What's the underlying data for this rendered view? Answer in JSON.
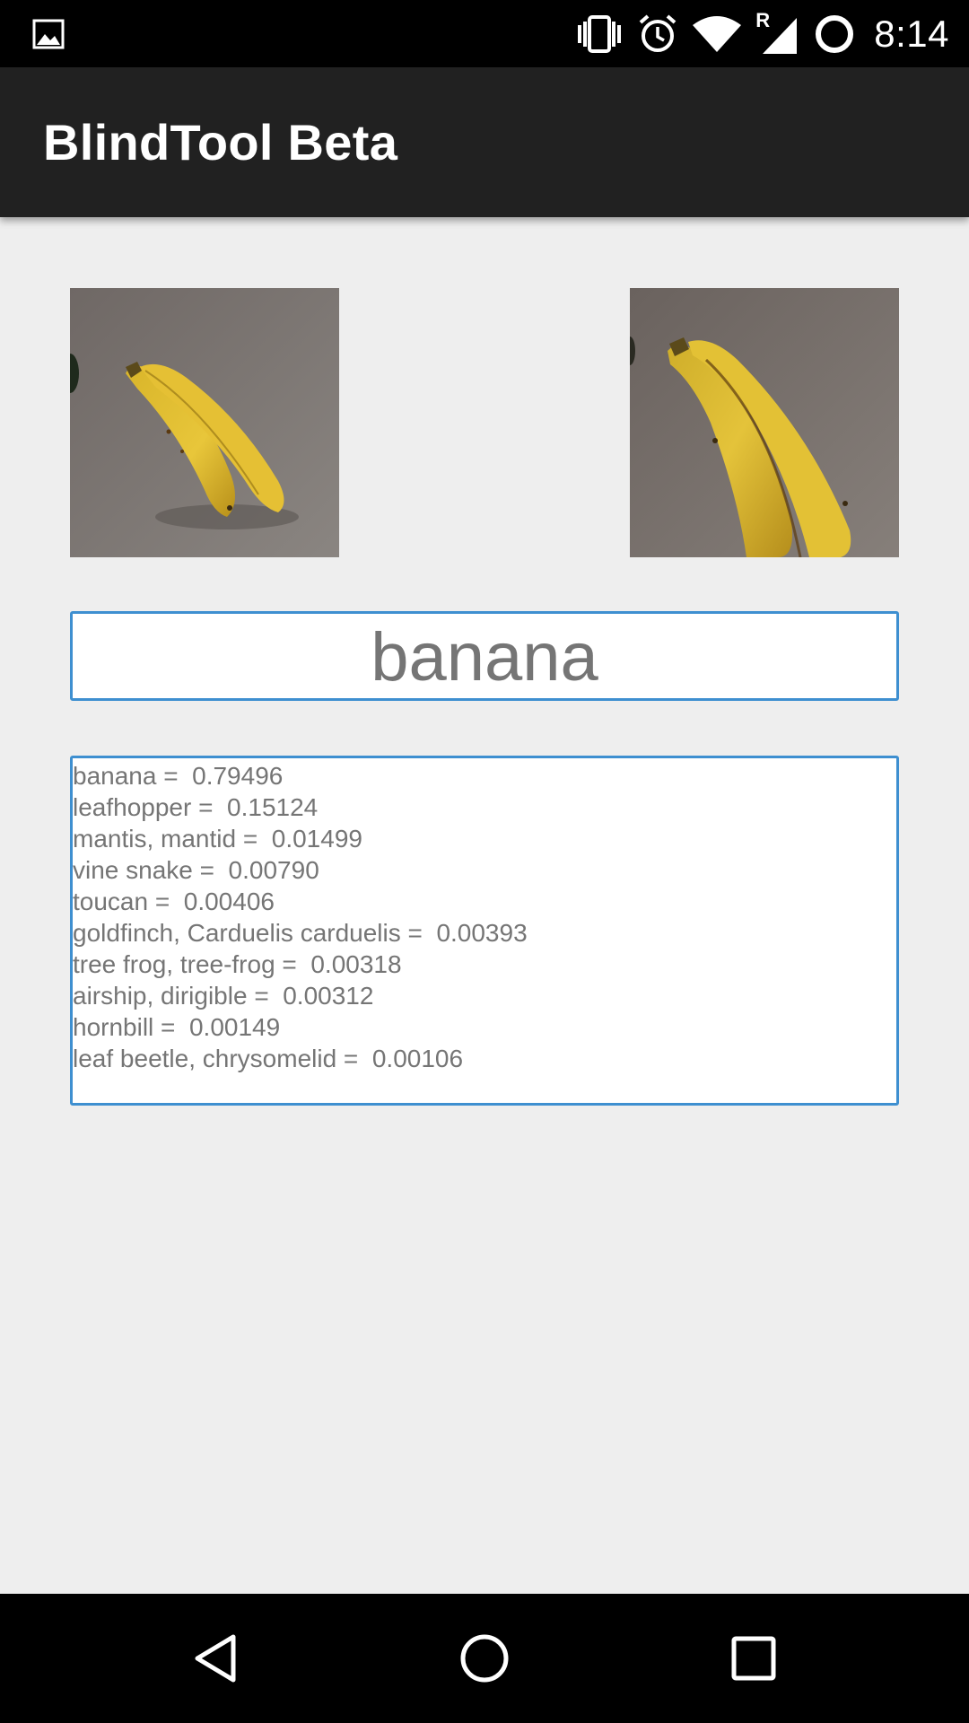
{
  "status_bar": {
    "time": "8:14",
    "icons": [
      "gallery-icon",
      "vibrate-icon",
      "alarm-icon",
      "wifi-icon",
      "signal-roaming-icon",
      "battery-ring-icon"
    ],
    "roaming_label": "R"
  },
  "app_bar": {
    "title": "BlindTool Beta",
    "background": "#212121"
  },
  "previews": [
    {
      "name": "camera-preview-left",
      "description_icon": "banana-photo"
    },
    {
      "name": "camera-preview-right",
      "description_icon": "banana-photo"
    }
  ],
  "result": {
    "label": "banana"
  },
  "predictions": [
    {
      "label": "banana",
      "score": "0.79496",
      "text": "banana =  0.79496"
    },
    {
      "label": "leafhopper",
      "score": "0.15124",
      "text": "leafhopper =  0.15124"
    },
    {
      "label": "mantis, mantid",
      "score": "0.01499",
      "text": "mantis, mantid =  0.01499"
    },
    {
      "label": "vine snake",
      "score": "0.00790",
      "text": "vine snake =  0.00790"
    },
    {
      "label": "toucan",
      "score": "0.00406",
      "text": "toucan =  0.00406"
    },
    {
      "label": "goldfinch, Carduelis carduelis",
      "score": "0.00393",
      "text": "goldfinch, Carduelis carduelis =  0.00393"
    },
    {
      "label": "tree frog, tree-frog",
      "score": "0.00318",
      "text": "tree frog, tree-frog =  0.00318"
    },
    {
      "label": "airship, dirigible",
      "score": "0.00312",
      "text": "airship, dirigible =  0.00312"
    },
    {
      "label": "hornbill",
      "score": "0.00149",
      "text": "hornbill =  0.00149"
    },
    {
      "label": "leaf beetle, chrysomelid",
      "score": "0.00106",
      "text": "leaf beetle, chrysomelid =  0.00106"
    }
  ],
  "nav_bar": {
    "buttons": [
      "back-icon",
      "home-icon",
      "recents-icon"
    ]
  },
  "colors": {
    "accent_border": "#3e8fd0",
    "text_gray": "#757575",
    "background": "#eeeeee"
  }
}
